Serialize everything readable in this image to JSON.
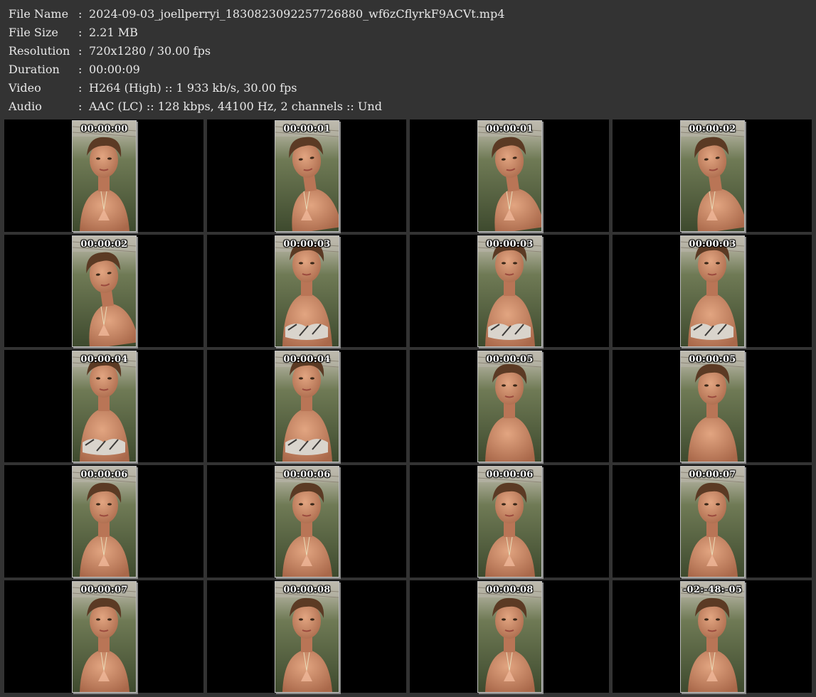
{
  "info": [
    {
      "label": "File Name",
      "value": "2024-09-03_joellperryi_1830823092257726880_wf6zCflyrkF9ACVt.mp4"
    },
    {
      "label": "File Size",
      "value": "2.21 MB"
    },
    {
      "label": "Resolution",
      "value": "720x1280 / 30.00 fps"
    },
    {
      "label": "Duration",
      "value": "00:00:09"
    },
    {
      "label": "Video",
      "value": "H264 (High) :: 1 933 kb/s, 30.00 fps"
    },
    {
      "label": "Audio",
      "value": "AAC (LC) :: 128 kbps, 44100 Hz, 2 channels :: Und"
    }
  ],
  "separator": ":",
  "thumbnails": [
    {
      "time": "00:00:00",
      "variant": "a"
    },
    {
      "time": "00:00:01",
      "variant": "b"
    },
    {
      "time": "00:00:01",
      "variant": "b"
    },
    {
      "time": "00:00:02",
      "variant": "b"
    },
    {
      "time": "00:00:02",
      "variant": "b"
    },
    {
      "time": "00:00:03",
      "variant": "c"
    },
    {
      "time": "00:00:03",
      "variant": "c"
    },
    {
      "time": "00:00:03",
      "variant": "c"
    },
    {
      "time": "00:00:04",
      "variant": "c"
    },
    {
      "time": "00:00:04",
      "variant": "c"
    },
    {
      "time": "00:00:05",
      "variant": "d"
    },
    {
      "time": "00:00:05",
      "variant": "d"
    },
    {
      "time": "00:00:06",
      "variant": "a"
    },
    {
      "time": "00:00:06",
      "variant": "a"
    },
    {
      "time": "00:00:06",
      "variant": "a"
    },
    {
      "time": "00:00:07",
      "variant": "a"
    },
    {
      "time": "00:00:07",
      "variant": "a"
    },
    {
      "time": "00:00:08",
      "variant": "a"
    },
    {
      "time": "00:00:08",
      "variant": "a"
    },
    {
      "time": "-02:-48:-05",
      "variant": "a"
    }
  ],
  "colors": {
    "background": "#333333",
    "cell": "#000000",
    "text": "#e8e8e8"
  }
}
